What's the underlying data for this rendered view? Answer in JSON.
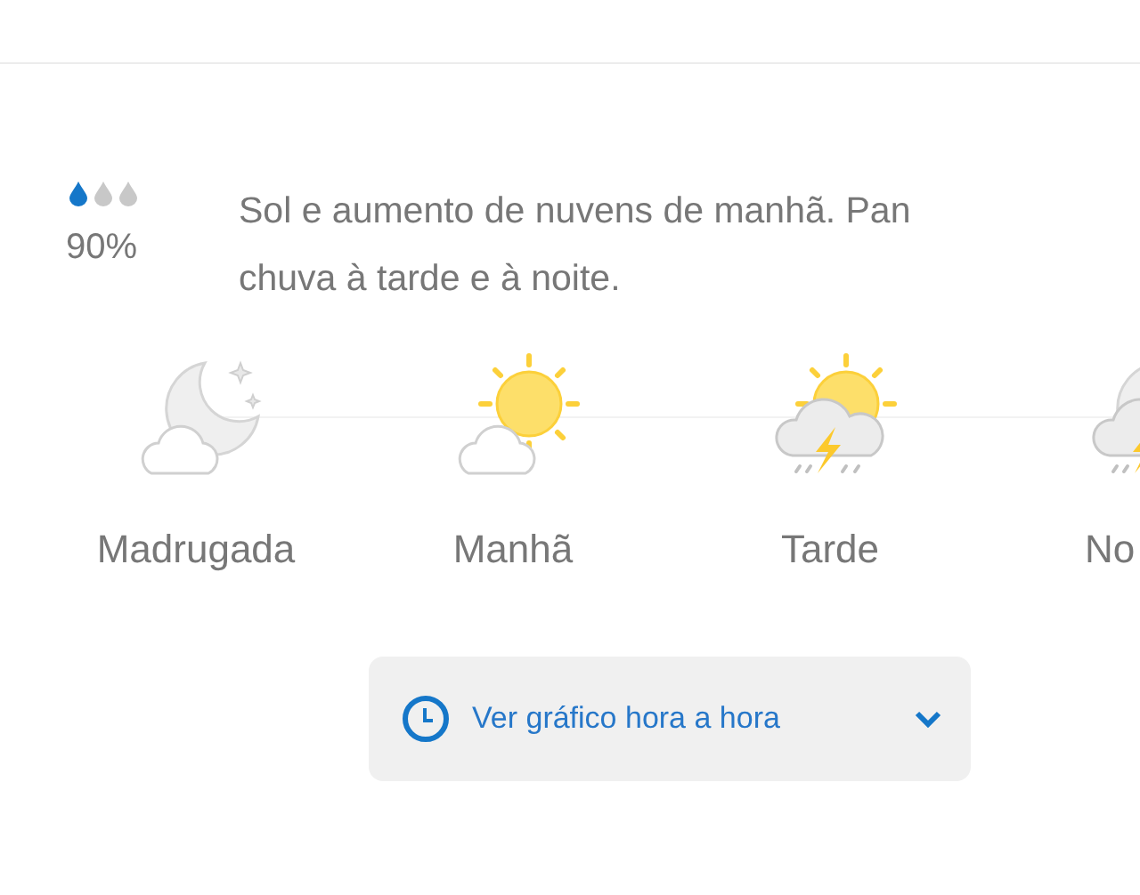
{
  "rain": {
    "drops": [
      {
        "filled": true
      },
      {
        "filled": false
      },
      {
        "filled": false
      }
    ],
    "chance": "90%"
  },
  "description": "Sol e aumento de nuvens de manhã. Pan\nchuva à tarde e à noite.",
  "periods": [
    {
      "label": "Madrugada",
      "kind": "moon-cloud"
    },
    {
      "label": "Manhã",
      "kind": "sun-cloud"
    },
    {
      "label": "Tarde",
      "kind": "sun-storm"
    },
    {
      "label": "No",
      "kind": "moon-storm"
    }
  ],
  "hourly_button": {
    "label": "Ver gráfico hora a hora"
  }
}
